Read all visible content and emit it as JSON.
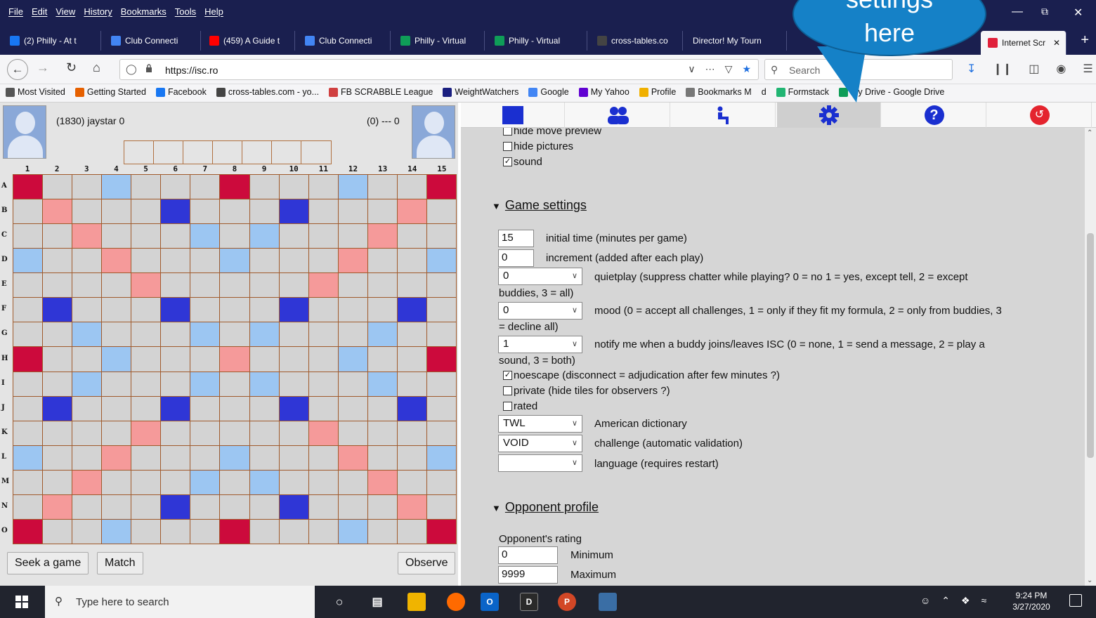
{
  "menubar": {
    "items": [
      "File",
      "Edit",
      "View",
      "History",
      "Bookmarks",
      "Tools",
      "Help"
    ]
  },
  "tabs": [
    {
      "label": "(2) Philly - At t",
      "icon": "facebook-icon",
      "color": "#1877f2"
    },
    {
      "label": "Club Connecti",
      "icon": "docs-icon",
      "color": "#4285f4"
    },
    {
      "label": "(459) A Guide t",
      "icon": "youtube-icon",
      "color": "#ff0000"
    },
    {
      "label": "Club Connecti",
      "icon": "docs-icon",
      "color": "#4285f4"
    },
    {
      "label": "Philly - Virtual",
      "icon": "x-icon",
      "color": "#0f9d58"
    },
    {
      "label": "Philly - Virtual",
      "icon": "x-icon",
      "color": "#0f9d58"
    },
    {
      "label": "cross-tables.co",
      "icon": "xt-icon",
      "color": "#444444"
    },
    {
      "label": "Director! My Tourn",
      "icon": "",
      "color": ""
    },
    {
      "label": "Internet Scr",
      "icon": "isc-icon",
      "color": "#e0203a",
      "active": true
    }
  ],
  "navbar": {
    "url": "https://isc.ro",
    "search_placeholder": "Search"
  },
  "bookmarks": [
    {
      "label": "Most Visited",
      "icon": "gear-icon",
      "color": "#555555"
    },
    {
      "label": "Getting Started",
      "icon": "firefox-icon",
      "color": "#e66000"
    },
    {
      "label": "Facebook",
      "icon": "facebook-icon",
      "color": "#1877f2"
    },
    {
      "label": "cross-tables.com - yo...",
      "icon": "xt-icon",
      "color": "#444444"
    },
    {
      "label": "FB SCRABBLE League",
      "icon": "scrabble-icon",
      "color": "#d04040"
    },
    {
      "label": "WeightWatchers",
      "icon": "ww-icon",
      "color": "#1a1f80"
    },
    {
      "label": "Google",
      "icon": "google-icon",
      "color": "#4285f4"
    },
    {
      "label": "My Yahoo",
      "icon": "yahoo-icon",
      "color": "#6001d2"
    },
    {
      "label": "Profile",
      "icon": "profile-icon",
      "color": "#f0b000"
    },
    {
      "label": "Bookmarks M",
      "icon": "folder-icon",
      "color": "#777777"
    },
    {
      "label": "d",
      "icon": "",
      "color": ""
    },
    {
      "label": "Formstack",
      "icon": "formstack-icon",
      "color": "#21b573"
    },
    {
      "label": "My Drive - Google Drive",
      "icon": "drive-icon",
      "color": "#0f9d58"
    }
  ],
  "game": {
    "player1": "(1830) jaystar 0",
    "player2": "(0) --- 0",
    "columns": [
      "1",
      "2",
      "3",
      "4",
      "5",
      "6",
      "7",
      "8",
      "9",
      "10",
      "11",
      "12",
      "13",
      "14",
      "15"
    ],
    "rows": [
      "A",
      "B",
      "C",
      "D",
      "E",
      "F",
      "G",
      "H",
      "I",
      "J",
      "K",
      "L",
      "M",
      "N",
      "O"
    ],
    "buttons": {
      "seek": "Seek a game",
      "match": "Match",
      "observe": "Observe"
    },
    "colors": {
      "triple_word": "#cc0a3c",
      "double_word": "#f59a9a",
      "triple_letter": "#2f36d6",
      "double_letter": "#9cc6f2",
      "plain": "#d3d3d3"
    }
  },
  "settings": {
    "checks_top": [
      {
        "label": "hide move preview",
        "checked": false
      },
      {
        "label": "hide pictures",
        "checked": false
      },
      {
        "label": "sound",
        "checked": true
      }
    ],
    "game_section": "Game settings",
    "initial_time": {
      "value": "15",
      "label": "initial time (minutes per game)"
    },
    "increment": {
      "value": "0",
      "label": "increment (added after each play)"
    },
    "quietplay": {
      "value": "0",
      "label1": "quietplay (suppress chatter while playing? 0 = no 1 = yes, except tell, 2 = except",
      "label2": "buddies, 3 = all)"
    },
    "mood": {
      "value": "0",
      "label1": "mood (0 = accept all challenges, 1 = only if they fit my formula, 2 = only from buddies, 3",
      "label2": "= decline all)"
    },
    "notify": {
      "value": "1",
      "label1": "notify me when a buddy joins/leaves ISC (0 = none, 1 = send a message, 2 = play a",
      "label2": "sound, 3 = both)"
    },
    "checks_game": [
      {
        "label": "noescape (disconnect = adjudication after few minutes ?)",
        "checked": true
      },
      {
        "label": "private (hide tiles for observers ?)",
        "checked": false
      },
      {
        "label": "rated",
        "checked": false
      }
    ],
    "dictionary": {
      "value": "TWL",
      "label": "American dictionary"
    },
    "challenge": {
      "value": "VOID",
      "label": "challenge (automatic validation)"
    },
    "language": {
      "value": "",
      "label": "language (requires restart)"
    },
    "opponent_section": "Opponent profile",
    "opponent_rating_label": "Opponent's rating",
    "min_rating": {
      "value": "0",
      "label": "Minimum"
    },
    "max_rating": {
      "value": "9999",
      "label": "Maximum"
    }
  },
  "callout": {
    "line1": "settings",
    "line2": "here"
  },
  "taskbar": {
    "search_placeholder": "Type here to search",
    "time": "9:24 PM",
    "date": "3/27/2020"
  }
}
